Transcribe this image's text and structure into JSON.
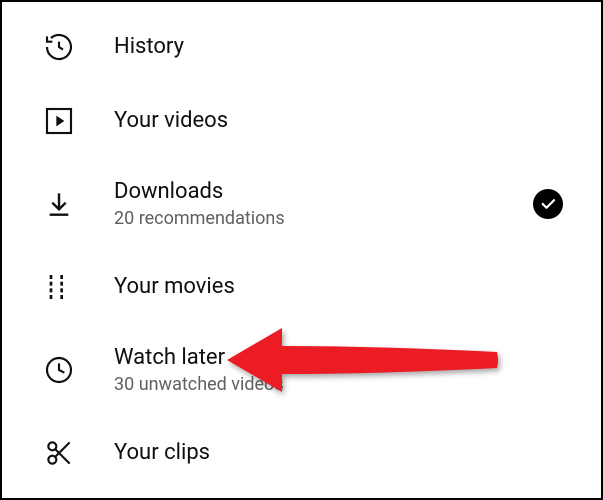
{
  "menu": {
    "items": [
      {
        "label": "History",
        "icon": "history"
      },
      {
        "label": "Your videos",
        "icon": "your-videos"
      },
      {
        "label": "Downloads",
        "sub": "20 recommendations",
        "icon": "download",
        "badge": true
      },
      {
        "label": "Your movies",
        "icon": "movies"
      },
      {
        "label": "Watch later",
        "sub": "30 unwatched videos",
        "icon": "clock"
      },
      {
        "label": "Your clips",
        "sub": "",
        "icon": "scissors"
      }
    ]
  }
}
